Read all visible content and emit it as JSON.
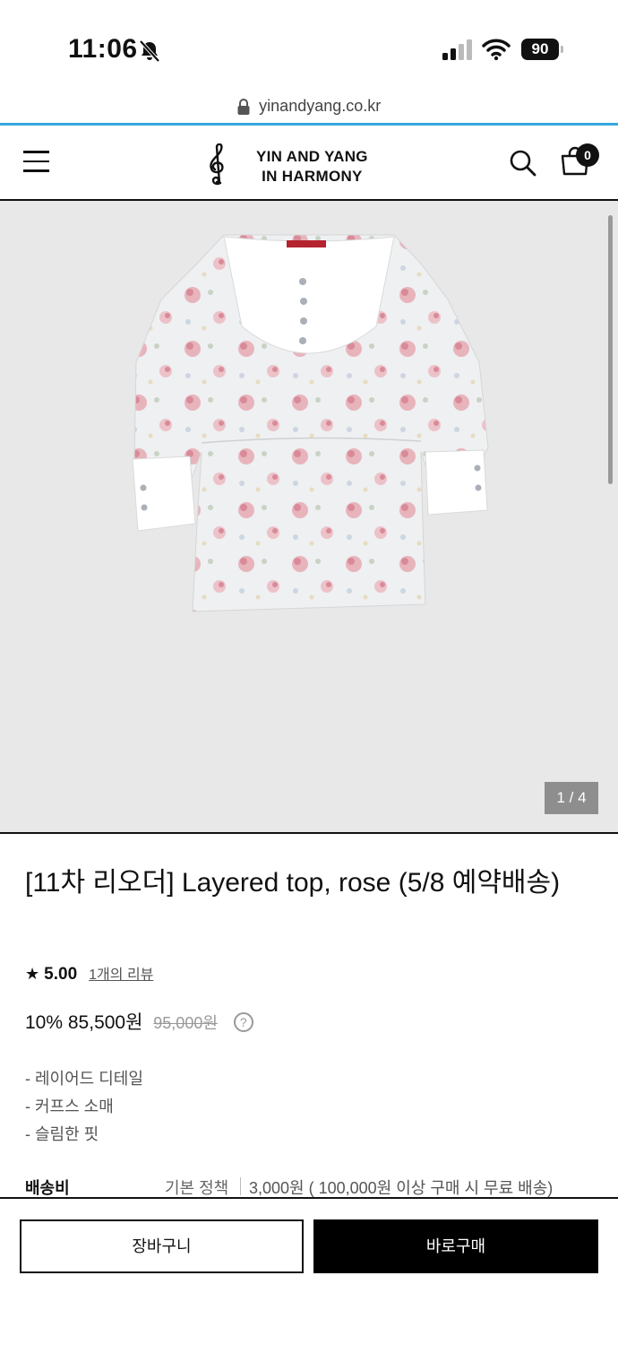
{
  "status_bar": {
    "time": "11:06",
    "battery": "90",
    "icons": [
      "bell-slash-icon",
      "signal-icon",
      "wifi-icon",
      "battery-icon"
    ]
  },
  "browser": {
    "url": "yinandyang.co.kr"
  },
  "header": {
    "logo_line1": "YIN AND YANG",
    "logo_line2": "IN HARMONY",
    "cart_count": "0",
    "icons": [
      "menu-icon",
      "treble-clef-icon",
      "search-icon",
      "shopping-bag-icon"
    ]
  },
  "gallery": {
    "counter": "1 / 4",
    "image": "floral layered top"
  },
  "product": {
    "title": "[11차 리오더] Layered top, rose (5/8 예약배송)",
    "rating_star": "★",
    "rating_score": "5.00",
    "reviews_link": "1개의 리뷰",
    "discount": "10%",
    "sale_price": "85,500원",
    "original_price": "95,000원",
    "help_icon": "?",
    "features": [
      "- 레이어드 디테일",
      "- 커프스 소매",
      "- 슬림한 핏"
    ],
    "shipping_label": "배송비",
    "shipping_policy": "기본 정책",
    "shipping_fee": "3,000원 ( 100,000원 이상 구매 시 무료 배송)"
  },
  "actions": {
    "cart_label": "장바구니",
    "buy_label": "바로구매"
  },
  "colors": {
    "accent_loading": "#35a7e0",
    "button_primary": "#000000",
    "gallery_bg": "#e8e8e8"
  }
}
